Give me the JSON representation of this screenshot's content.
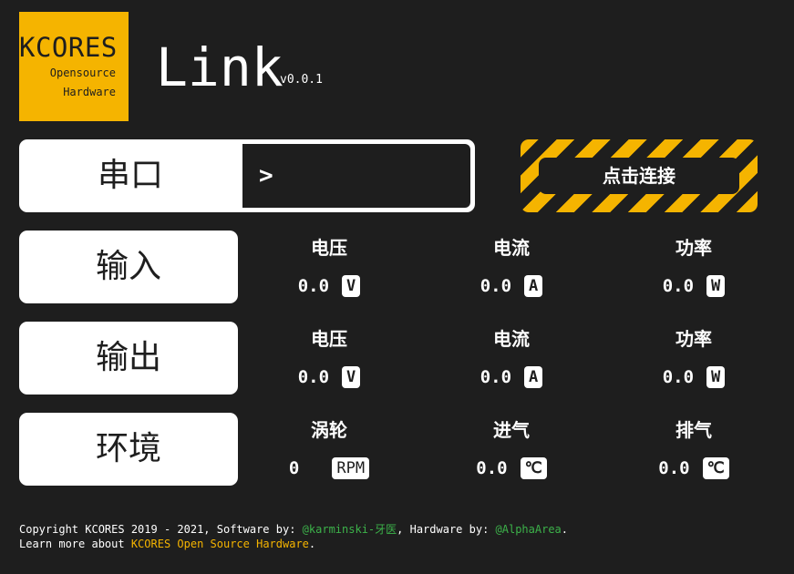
{
  "logo": {
    "main": "KCORES",
    "line1": "Opensource",
    "line2": "Hardware"
  },
  "app": {
    "title": "Link",
    "version": "v0.0.1"
  },
  "serial": {
    "label": "串口",
    "prompt": ">",
    "value": ""
  },
  "connect": {
    "label": "点击连接"
  },
  "rows": [
    {
      "label": "输入",
      "metrics": [
        {
          "title": "电压",
          "value": "0.0",
          "unit": "V"
        },
        {
          "title": "电流",
          "value": "0.0",
          "unit": "A"
        },
        {
          "title": "功率",
          "value": "0.0",
          "unit": "W"
        }
      ]
    },
    {
      "label": "输出",
      "metrics": [
        {
          "title": "电压",
          "value": "0.0",
          "unit": "V"
        },
        {
          "title": "电流",
          "value": "0.0",
          "unit": "A"
        },
        {
          "title": "功率",
          "value": "0.0",
          "unit": "W"
        }
      ]
    },
    {
      "label": "环境",
      "metrics": [
        {
          "title": "涡轮",
          "value": "0",
          "unit": "RPM"
        },
        {
          "title": "进气",
          "value": "0.0",
          "unit": "℃"
        },
        {
          "title": "排气",
          "value": "0.0",
          "unit": "℃"
        }
      ]
    }
  ],
  "footer": {
    "copyright_prefix": "Copyright KCORES 2019 - 2021, Software by: ",
    "software_author": "@karminski-牙医",
    "hardware_prefix": ", Hardware by: ",
    "hardware_author": "@AlphaArea",
    "period": ".",
    "learn_prefix": "Learn more about ",
    "learn_link": "KCORES Open Source Hardware",
    "learn_suffix": "."
  },
  "colors": {
    "background": "#1e1e1e",
    "accent": "#f5b400",
    "panel": "#ffffff",
    "link_green": "#3cb24a"
  }
}
